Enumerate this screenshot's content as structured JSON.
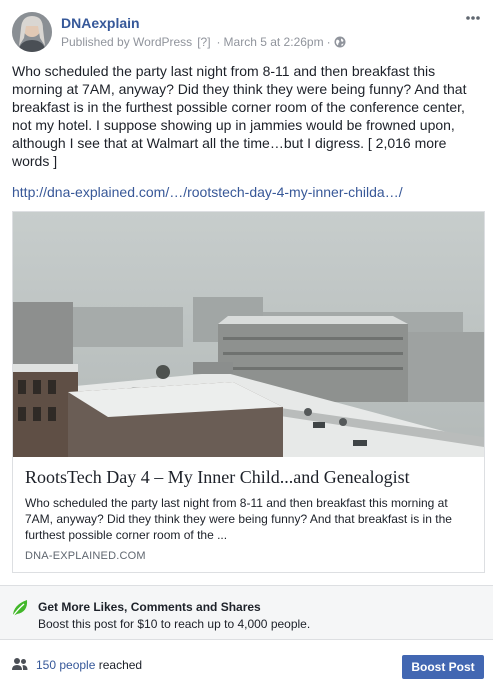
{
  "post": {
    "author": "DNAexplain",
    "publisher": "Published by WordPress",
    "help_marker": "[?]",
    "date": "March 5 at 2:26pm",
    "separator": "·",
    "text": "Who scheduled the party last night from 8-11 and then breakfast this morning at 7AM, anyway? Did they think they were being funny? And that breakfast is in the furthest possible corner room of the conference center, not my hotel. I suppose showing up in jammies would be frowned upon, although I see that at Walmart all the time…but I digress. [ 2,016 more words ]",
    "link": "http://dna-explained.com/…/rootstech-day-4-my-inner-childa…/"
  },
  "card": {
    "title": "RootsTech Day 4 – My Inner Child...and Genealogist",
    "description": "Who scheduled the party last night from 8-11 and then breakfast this morning at 7AM, anyway? Did they think they were being funny? And that breakfast is in the furthest possible corner room of the ...",
    "domain": "DNA-EXPLAINED.COM"
  },
  "boost_promo": {
    "title": "Get More Likes, Comments and Shares",
    "subtitle": "Boost this post for $10 to reach up to 4,000 people."
  },
  "footer": {
    "reach_count": "150 people",
    "reach_suffix": " reached",
    "boost_button": "Boost Post"
  },
  "icons": {
    "more": "more-options-icon",
    "globe": "globe-icon",
    "leaf": "leaf-icon",
    "people": "people-icon"
  },
  "colors": {
    "link_blue": "#365899",
    "button_blue": "#4267b2",
    "leaf_green": "#42b72a",
    "meta_gray": "#90949c"
  }
}
